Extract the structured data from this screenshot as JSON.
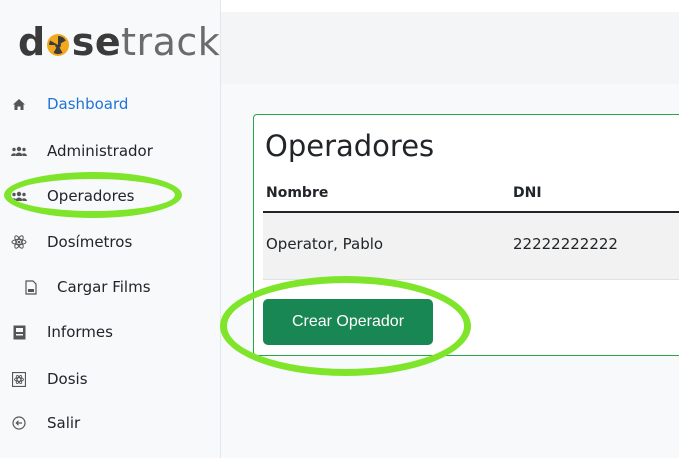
{
  "app": {
    "logo_prefix": "d",
    "logo_middle": "se",
    "logo_suffix": "track"
  },
  "sidebar": {
    "items": [
      {
        "label": "Dashboard",
        "icon": "home-icon",
        "active": true
      },
      {
        "label": "Administrador",
        "icon": "users-icon",
        "active": false
      },
      {
        "label": "Operadores",
        "icon": "users-icon",
        "active": false
      },
      {
        "label": "Dosímetros",
        "icon": "atom-icon",
        "active": false
      },
      {
        "label": "Cargar Films",
        "icon": "file-icon",
        "active": false
      },
      {
        "label": "Informes",
        "icon": "report-icon",
        "active": false
      },
      {
        "label": "Dosis",
        "icon": "dose-icon",
        "active": false
      },
      {
        "label": "Salir",
        "icon": "exit-icon",
        "active": false
      }
    ]
  },
  "main": {
    "title": "Operadores",
    "columns": [
      "Nombre",
      "DNI"
    ],
    "rows": [
      {
        "nombre": "Operator, Pablo",
        "dni": "22222222222"
      }
    ],
    "create_button": "Crear Operador"
  },
  "colors": {
    "accent": "#1e73d8",
    "button": "#198754",
    "card_border": "#28a745",
    "highlight": "#7ee52a"
  }
}
